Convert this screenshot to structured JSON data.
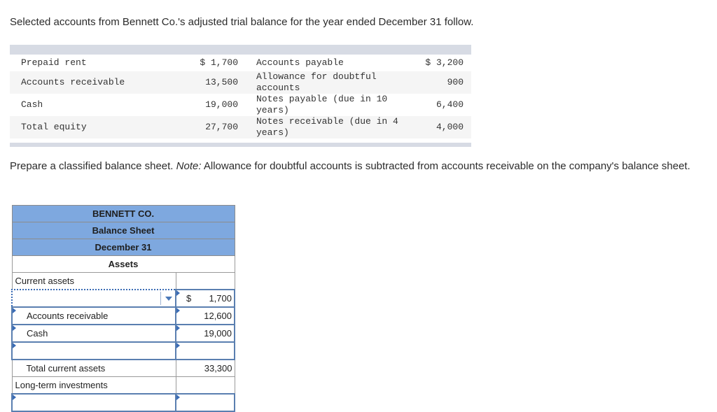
{
  "intro_text": "Selected accounts from Bennett Co.'s adjusted trial balance for the year ended December 31 follow.",
  "given_accounts": [
    {
      "left_name": "Prepaid rent",
      "left_amount": "$ 1,700",
      "right_name": "Accounts payable",
      "right_amount": "$ 3,200"
    },
    {
      "left_name": "Accounts receivable",
      "left_amount": "13,500",
      "right_name": "Allowance for doubtful accounts",
      "right_amount": "900"
    },
    {
      "left_name": "Cash",
      "left_amount": "19,000",
      "right_name": "Notes payable (due in 10 years)",
      "right_amount": "6,400"
    },
    {
      "left_name": "Total equity",
      "left_amount": "27,700",
      "right_name": "Notes receivable (due in 4 years)",
      "right_amount": "4,000"
    }
  ],
  "instructions": {
    "lead": "Prepare a classified balance sheet. ",
    "note_label": "Note:",
    "note_text": " Allowance for doubtful accounts is subtracted from accounts receivable on the company's balance sheet."
  },
  "balance_sheet": {
    "company": "BENNETT CO.",
    "title": "Balance Sheet",
    "date": "December 31",
    "section_assets": "Assets",
    "current_assets_label": "Current assets",
    "rows": [
      {
        "label": "",
        "value": "1,700",
        "currency": "$",
        "type": "dropdown"
      },
      {
        "label": "Accounts receivable",
        "value": "12,600",
        "type": "input"
      },
      {
        "label": "Cash",
        "value": "19,000",
        "type": "input"
      },
      {
        "label": "",
        "value": "",
        "type": "input"
      }
    ],
    "total_current_assets_label": "Total current assets",
    "total_current_assets_value": "33,300",
    "long_term_investments_label": "Long-term investments"
  }
}
